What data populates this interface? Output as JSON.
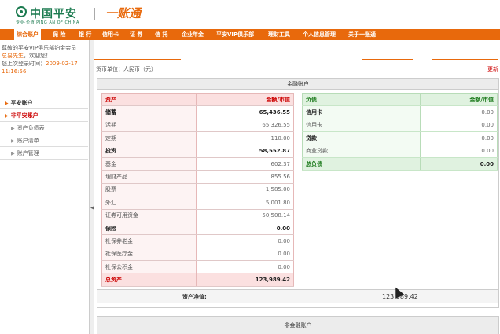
{
  "header": {
    "logo_cn": "中国平安",
    "logo_small": "专业·价值  PING AN OF CHINA",
    "product": "一账通"
  },
  "nav": {
    "items": [
      {
        "label": "综合账户",
        "active": true
      },
      {
        "label": "保 险"
      },
      {
        "label": "银 行"
      },
      {
        "label": "信用卡"
      },
      {
        "label": "证 券"
      },
      {
        "label": "信 托"
      },
      {
        "label": "企业年金"
      },
      {
        "label": "平安VIP俱乐部"
      },
      {
        "label": "理财工具"
      },
      {
        "label": "个人信息管理"
      },
      {
        "label": "关于一账通"
      }
    ]
  },
  "sidebar": {
    "welcome_line1": "尊敬的平安VIP俱乐部铂金会员",
    "user_name": "总易先生",
    "welcome_suffix": "，欢迎您！",
    "last_login_label": "您上次登录时间：",
    "last_login_date": "2009-02-17",
    "last_login_time": "11:16:56",
    "items": [
      {
        "label": "平安账户",
        "kind": "top"
      },
      {
        "label": "非平安账户",
        "kind": "cur"
      },
      {
        "label": "资产负债表",
        "kind": "sub"
      },
      {
        "label": "账户清单",
        "kind": "sub"
      },
      {
        "label": "账户管理",
        "kind": "sub"
      }
    ]
  },
  "main": {
    "currency_label": "货币单位：人民币（元）",
    "refresh_label": "更新",
    "financial_title": "金融账户",
    "assets": {
      "header_label": "资产",
      "header_value": "金额/市值",
      "rows": [
        {
          "label": "储蓄",
          "value": "65,436.55",
          "bold": true
        },
        {
          "label": "活期",
          "value": "65,326.55"
        },
        {
          "label": "定期",
          "value": "110.00"
        },
        {
          "label": "投资",
          "value": "58,552.87",
          "bold": true
        },
        {
          "label": "基金",
          "value": "602.37"
        },
        {
          "label": "理财产品",
          "value": "855.56"
        },
        {
          "label": "股票",
          "value": "1,585.00"
        },
        {
          "label": "外汇",
          "value": "5,001.80"
        },
        {
          "label": "证券可用资金",
          "value": "50,508.14"
        },
        {
          "label": "保险",
          "value": "0.00",
          "bold": true
        },
        {
          "label": "社保养老金",
          "value": "0.00"
        },
        {
          "label": "社保医疗金",
          "value": "0.00"
        },
        {
          "label": "社保公积金",
          "value": "0.00"
        }
      ],
      "total_label": "总资产",
      "total_value": "123,989.42"
    },
    "liabilities": {
      "header_label": "负债",
      "header_value": "金额/市值",
      "rows": [
        {
          "label": "信用卡",
          "value": "0.00",
          "bold": true
        },
        {
          "label": "信用卡",
          "value": "0.00"
        },
        {
          "label": "贷款",
          "value": "0.00",
          "bold": true
        },
        {
          "label": "商业贷款",
          "value": "0.00"
        }
      ],
      "total_label": "总负债",
      "total_value": "0.00"
    },
    "net_worth_label": "资产净值:",
    "net_worth_value": "123,989.42",
    "non_financial_title": "非金融账户"
  },
  "colors": {
    "brand_orange": "#e8690c",
    "brand_green": "#1b7a4f",
    "asset_red": "#c00000",
    "liability_green": "#1b7a1b"
  }
}
